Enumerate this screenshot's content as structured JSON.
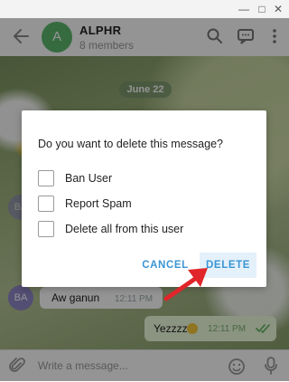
{
  "chat": {
    "name": "ALPHR",
    "members": "8 members",
    "avatar_letter": "A",
    "date_divider": "June 22"
  },
  "messages": {
    "incoming": {
      "avatar": "BA",
      "text": "Aw ganun",
      "time": "12:11 PM"
    },
    "outgoing": {
      "text": "Yezzzz",
      "time": "12:11 PM"
    }
  },
  "composer": {
    "placeholder": "Write a message..."
  },
  "dialog": {
    "title": "Do you want to delete this message?",
    "options": [
      {
        "label": "Ban User",
        "checked": false
      },
      {
        "label": "Report Spam",
        "checked": false
      },
      {
        "label": "Delete all from this user",
        "checked": false
      }
    ],
    "cancel_label": "CANCEL",
    "delete_label": "DELETE"
  },
  "colors": {
    "accent": "#3a95d5",
    "avatar_green": "#5db96f",
    "avatar_purple": "#8f87c7",
    "annotation_red": "#e0262a"
  },
  "icons": [
    "back-arrow-icon",
    "search-icon",
    "chat-icon",
    "more-icon",
    "paperclip-icon",
    "emoji-icon",
    "microphone-icon",
    "double-check-icon"
  ]
}
